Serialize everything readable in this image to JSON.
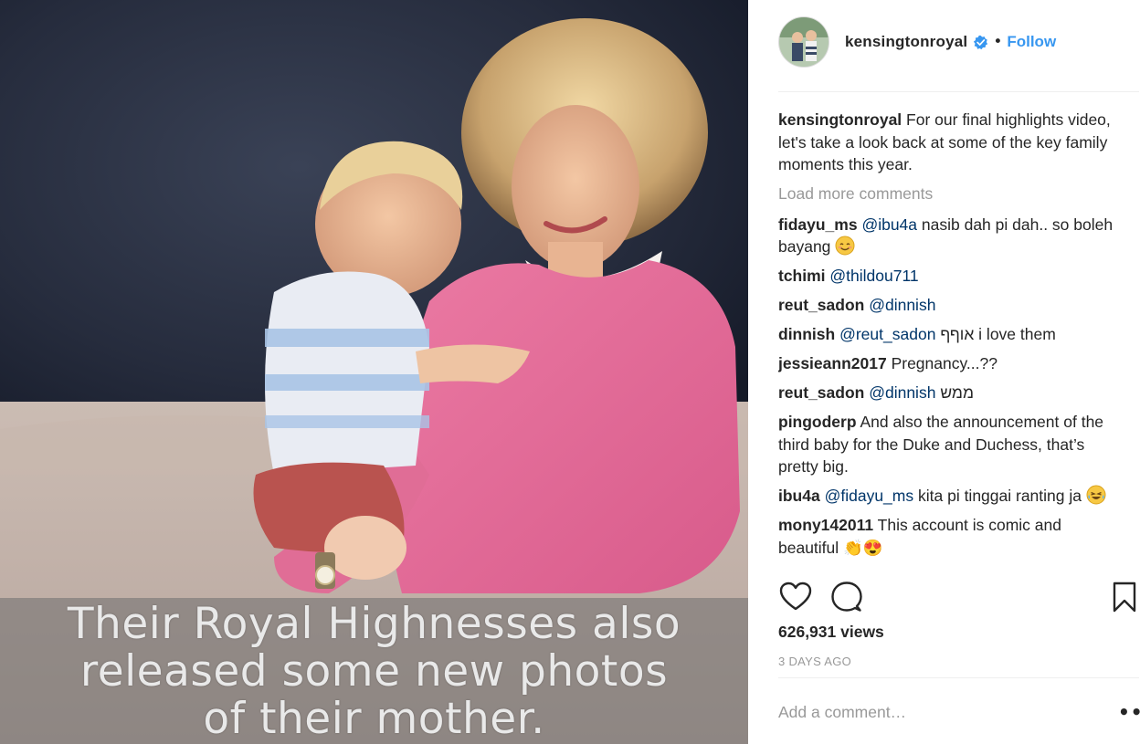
{
  "media": {
    "caption_lines": [
      "Their Royal Highnesses also",
      "released some new photos",
      "of their mother."
    ]
  },
  "header": {
    "username": "kensingtonroyal",
    "separator": "•",
    "follow_label": "Follow"
  },
  "caption": {
    "username": "kensingtonroyal",
    "text": "For our final highlights video, let's take a look back at some of the key family moments this year."
  },
  "load_more_label": "Load more comments",
  "comments": [
    {
      "user": "fidayu_ms",
      "mention": "@ibu4a",
      "text": " nasib dah pi dah.. so boleh bayang ",
      "emoji": "smiling-face-icon"
    },
    {
      "user": "tchimi",
      "mention": "@thildou711",
      "text": ""
    },
    {
      "user": "reut_sadon",
      "mention": "@dinnish",
      "text": ""
    },
    {
      "user": "dinnish",
      "mention": "@reut_sadon",
      "text": " אוףף i love them"
    },
    {
      "user": "jessieann2017",
      "mention": "",
      "text": " Pregnancy...??"
    },
    {
      "user": "reut_sadon",
      "mention": "@dinnish",
      "text": " ממש"
    },
    {
      "user": "pingoderp",
      "mention": "",
      "text": " And also the announcement of the third baby for the Duke and Duchess, that’s pretty big."
    },
    {
      "user": "ibu4a",
      "mention": "@fidayu_ms",
      "text": " kita pi tinggai ranting ja ",
      "emoji": "crying-laughing-face-icon"
    },
    {
      "user": "mony142011",
      "mention": "",
      "text": "  This account is comic and beautiful 👏😍"
    }
  ],
  "stats": {
    "views": "626,931 views",
    "time": "3 DAYS AGO"
  },
  "add_comment": {
    "placeholder": "Add a comment…",
    "more_label": "•••"
  },
  "colors": {
    "link_blue": "#3897f0",
    "mention_blue": "#003569",
    "muted_gray": "#999999",
    "text": "#262626",
    "verified_blue": "#3897f0"
  }
}
